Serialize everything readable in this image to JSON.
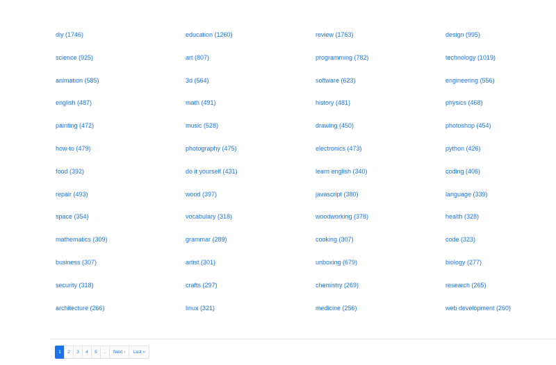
{
  "colors": {
    "link": "#1a73e8",
    "active_page_bg": "#1a73e8",
    "border": "#dee2e6"
  },
  "tags": [
    "diy (1746)",
    "education (1260)",
    "review (1763)",
    "design (995)",
    "science (925)",
    "art (807)",
    "programming (782)",
    "technology (1019)",
    "animation (585)",
    "3d (564)",
    "software (623)",
    "engineering (556)",
    "english (487)",
    "math (491)",
    "history (481)",
    "physics (468)",
    "painting (472)",
    "music (528)",
    "drawing (450)",
    "photoshop (454)",
    "how-to (479)",
    "photography (475)",
    "electronics (473)",
    "python (426)",
    "food (392)",
    "do it yourself (431)",
    "learn english (340)",
    "coding (406)",
    "repair (493)",
    "wood (397)",
    "javascript (380)",
    "language (339)",
    "space (354)",
    "vocabulary (318)",
    "woodworking (378)",
    "health (328)",
    "mathematics (309)",
    "grammar (289)",
    "cooking (307)",
    "code (323)",
    "business (307)",
    "artist (301)",
    "unboxing (679)",
    "biology (277)",
    "security (318)",
    "crafts (297)",
    "chemistry (269)",
    "research (265)",
    "architecture (266)",
    "linux (321)",
    "medicine (256)",
    "web development (260)"
  ],
  "pagination": {
    "pages": [
      "1",
      "2",
      "3",
      "4",
      "5"
    ],
    "active": "1",
    "ellipsis": "...",
    "next_label": "Next ›",
    "last_label": "Last »"
  }
}
